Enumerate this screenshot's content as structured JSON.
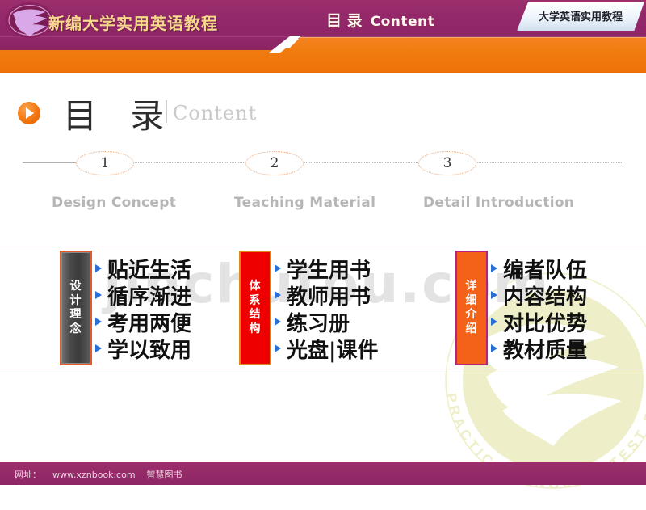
{
  "header": {
    "logo_icon": "swoosh-seal-logo",
    "brand_title": "新编大学实用英语教程",
    "badge_label": "大学英语实用教程",
    "bar_cn": "目 录",
    "bar_en": "Content"
  },
  "title": {
    "play_icon": "play-circle-icon",
    "cn": "目 录",
    "en": "Content"
  },
  "steps": [
    {
      "number": "1",
      "label": "Design Concept"
    },
    {
      "number": "2",
      "label": "Teaching Material"
    },
    {
      "number": "3",
      "label": "Detail  Introduction"
    }
  ],
  "columns": [
    {
      "tab_chars": [
        "设",
        "计",
        "理",
        "念"
      ],
      "tab_color": "#4a4a4a",
      "border_color": "#e4582a",
      "items": [
        "贴近生活",
        "循序渐进",
        "考用两便",
        "学以致用"
      ]
    },
    {
      "tab_chars": [
        "体",
        "系",
        "结",
        "构"
      ],
      "tab_color": "#ef0000",
      "border_color": "#d98a1e",
      "items": [
        "学生用书",
        "教师用书",
        "练习册",
        "光盘|课件"
      ]
    },
    {
      "tab_chars": [
        "详",
        "细",
        "介",
        "绍"
      ],
      "tab_color": "#f4621a",
      "border_color": "#b4247e",
      "items": [
        "编者队伍",
        "内容结构",
        "对比优势",
        "教材质量"
      ]
    }
  ],
  "watermark": {
    "text": "jinchutou.com",
    "logo_text": "PRACTICAL ENGLISH TEST FOR C"
  },
  "footer": {
    "label": "网址：",
    "url": "www.xznbook.com",
    "publisher": "智慧图书"
  },
  "colors": {
    "purple": "#93286a",
    "orange": "#f07c10",
    "gold": "#f6d98c",
    "bullet_blue": "#2a6fd6",
    "watermark_grey": "#e3e3e3",
    "watermark_yellow": "#eeeec8"
  }
}
